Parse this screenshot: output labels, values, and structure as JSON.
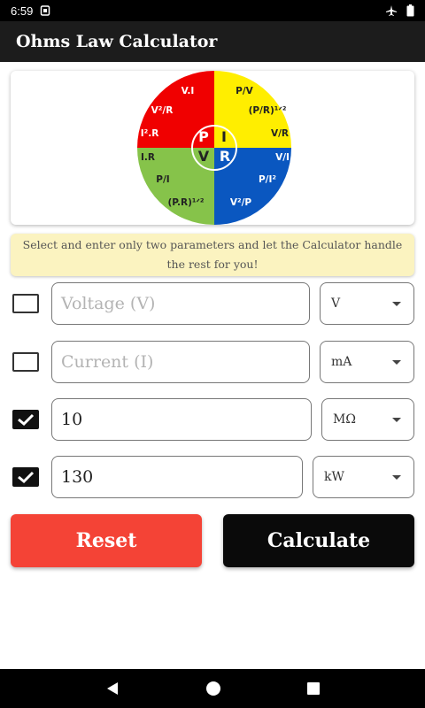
{
  "status": {
    "time": "6:59",
    "notification_icon": "sim-icon"
  },
  "app": {
    "title": "Ohms Law Calculator"
  },
  "wheel": {
    "quadrants": [
      {
        "name": "power",
        "color": "#f00000",
        "formulas": [
          "V.I",
          "V²/R",
          "I².R"
        ]
      },
      {
        "name": "current",
        "color": "#ffee00",
        "formulas": [
          "P/V",
          "(P/R)¹ᐟ²",
          "V/R"
        ]
      },
      {
        "name": "voltage",
        "color": "#86c34a",
        "formulas": [
          "I.R",
          "P/I",
          "(P.R)¹ᐟ²"
        ]
      },
      {
        "name": "resistance",
        "color": "#0a57c0",
        "formulas": [
          "V/I",
          "P/I²",
          "V²/P"
        ]
      }
    ],
    "center": {
      "p": "P",
      "i": "I",
      "v": "V",
      "r": "R"
    }
  },
  "hint": "Select and enter only two parameters and let the Calculator handle the rest for you!",
  "rows": [
    {
      "checked": false,
      "placeholder": "Voltage (V)",
      "value": "",
      "unit": "V"
    },
    {
      "checked": false,
      "placeholder": "Current (I)",
      "value": "",
      "unit": "mA"
    },
    {
      "checked": true,
      "placeholder": "",
      "value": "10",
      "unit": "MΩ"
    },
    {
      "checked": true,
      "placeholder": "",
      "value": "130",
      "unit": "kW"
    }
  ],
  "buttons": {
    "reset": "Reset",
    "calculate": "Calculate"
  }
}
